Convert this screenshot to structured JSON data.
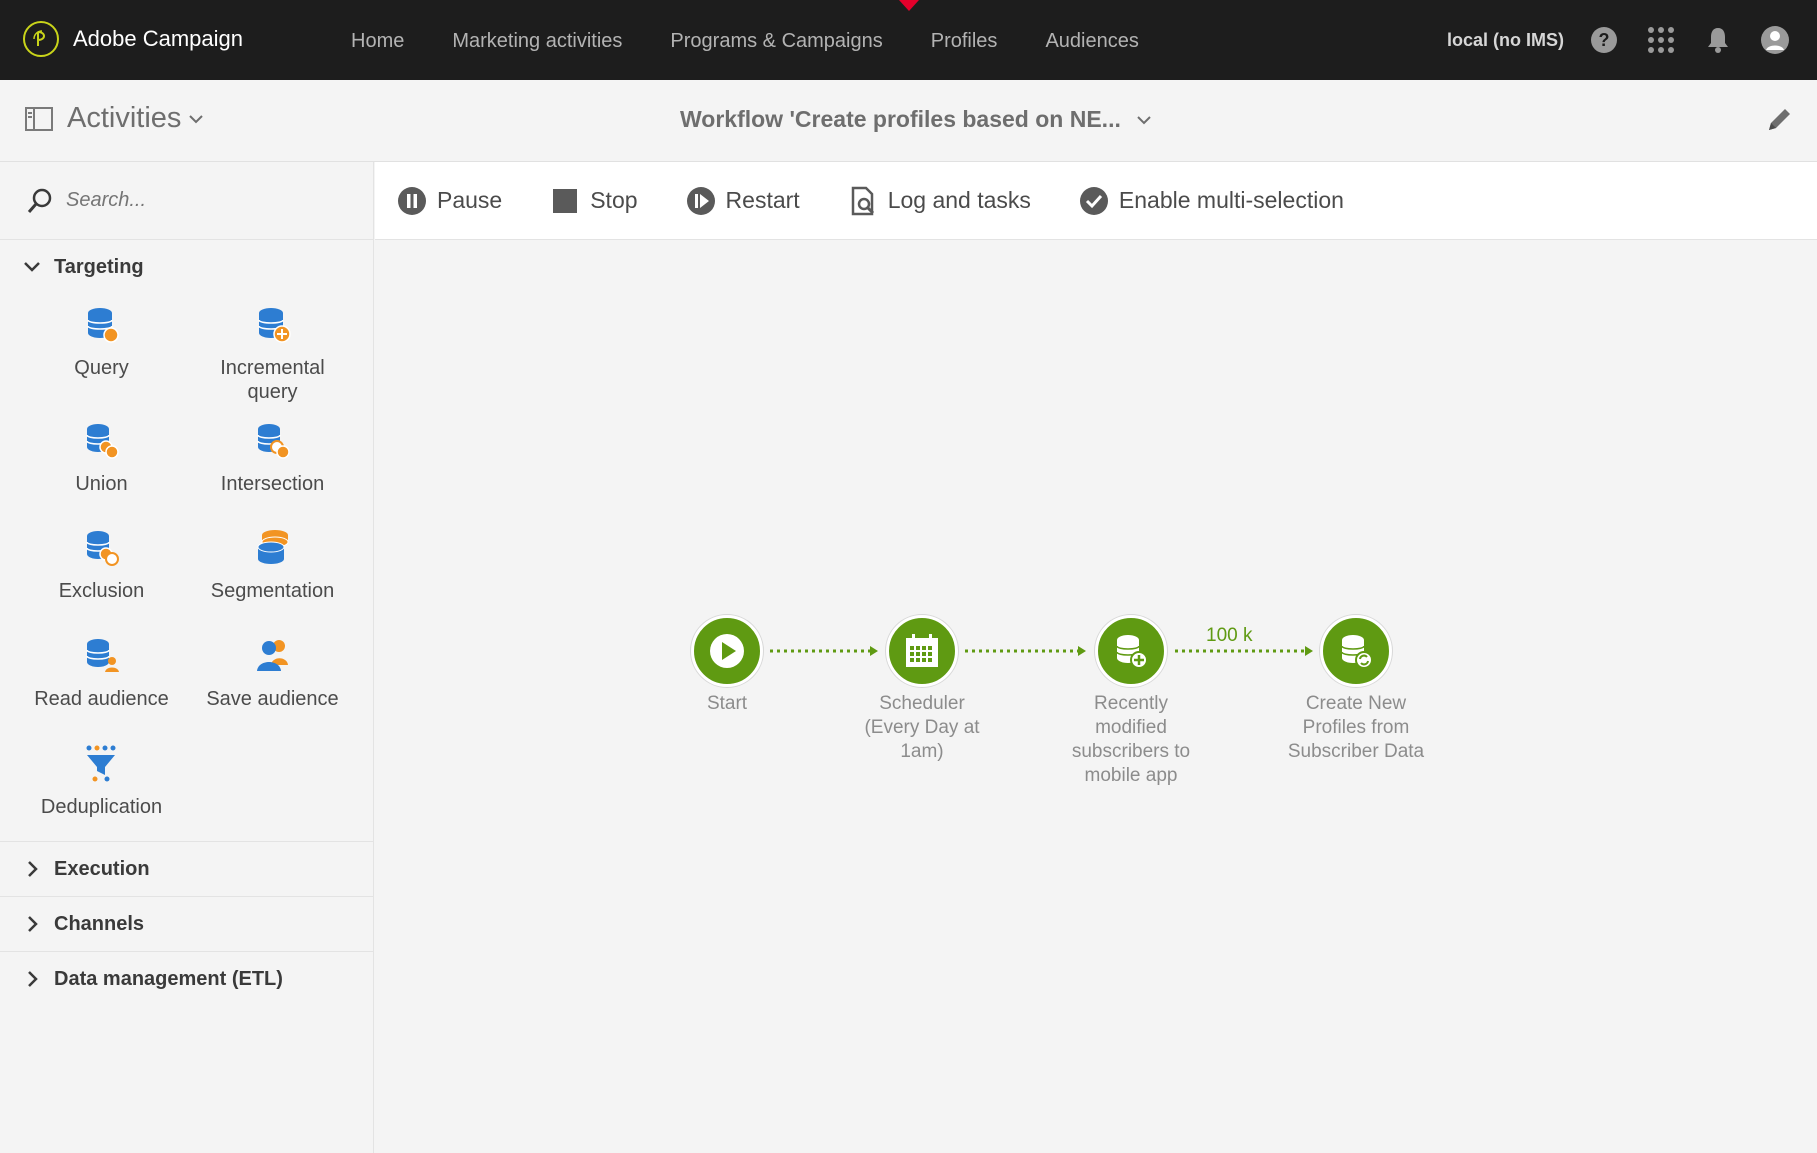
{
  "app": {
    "name": "Adobe Campaign"
  },
  "nav": {
    "items": [
      {
        "label": "Home"
      },
      {
        "label": "Marketing activities"
      },
      {
        "label": "Programs & Campaigns"
      },
      {
        "label": "Profiles"
      },
      {
        "label": "Audiences"
      }
    ]
  },
  "topbar": {
    "environment": "local (no IMS)"
  },
  "subheader": {
    "activities_label": "Activities",
    "workflow_title": "Workflow 'Create profiles based on NE..."
  },
  "sidebar": {
    "search_placeholder": "Search...",
    "sections": {
      "targeting": "Targeting",
      "execution": "Execution",
      "channels": "Channels",
      "data_management": "Data management (ETL)"
    },
    "activities": [
      {
        "label": "Query",
        "icon": "query-icon"
      },
      {
        "label": "Incremental query",
        "icon": "incremental-query-icon"
      },
      {
        "label": "Union",
        "icon": "union-icon"
      },
      {
        "label": "Intersection",
        "icon": "intersection-icon"
      },
      {
        "label": "Exclusion",
        "icon": "exclusion-icon"
      },
      {
        "label": "Segmentation",
        "icon": "segmentation-icon"
      },
      {
        "label": "Read audience",
        "icon": "read-audience-icon"
      },
      {
        "label": "Save audience",
        "icon": "save-audience-icon"
      },
      {
        "label": "Deduplication",
        "icon": "deduplication-icon"
      }
    ]
  },
  "toolbar": {
    "pause": "Pause",
    "stop": "Stop",
    "restart": "Restart",
    "log": "Log and tasks",
    "multi": "Enable multi-selection"
  },
  "workflow": {
    "nodes": [
      {
        "label": "Start",
        "icon": "play-icon"
      },
      {
        "label": "Scheduler (Every Day at 1am)",
        "icon": "calendar-icon"
      },
      {
        "label": "Recently modified subscribers to mobile app",
        "icon": "database-add-icon"
      },
      {
        "label": "Create New Profiles from Subscriber Data",
        "icon": "database-refresh-icon"
      }
    ],
    "transition_count": "100 k"
  },
  "colors": {
    "topbar": "#1d1d1d",
    "accent_green": "#5f9a12",
    "marker_red": "#e4002b",
    "icon_blue": "#2d7dd2",
    "icon_orange": "#f29423"
  }
}
